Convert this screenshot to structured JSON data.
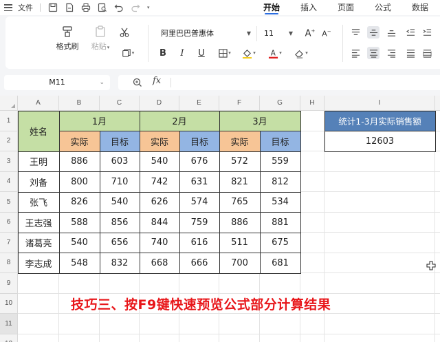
{
  "topbar": {
    "file_label": "文件",
    "tabs": [
      {
        "label": "开始",
        "active": true
      },
      {
        "label": "插入",
        "active": false
      },
      {
        "label": "页面",
        "active": false
      },
      {
        "label": "公式",
        "active": false
      },
      {
        "label": "数据",
        "active": false
      }
    ]
  },
  "ribbon": {
    "format_painter_label": "格式刷",
    "paste_label": "粘贴",
    "font_name": "阿里巴巴普惠体",
    "font_size": "11",
    "bold": "B",
    "italic": "I",
    "underline": "U"
  },
  "formula_bar": {
    "name_box": "M11",
    "fx": "fx",
    "formula": ""
  },
  "grid": {
    "columns": [
      "A",
      "B",
      "C",
      "D",
      "E",
      "F",
      "G",
      "H",
      "I"
    ],
    "rows": [
      "1",
      "2",
      "3",
      "4",
      "5",
      "6",
      "7",
      "8",
      "9",
      "10",
      "11",
      "12"
    ],
    "selected_row": "11"
  },
  "table": {
    "name_header": "姓名",
    "months": [
      "1月",
      "2月",
      "3月"
    ],
    "actual_label": "实际",
    "target_label": "目标",
    "records": [
      {
        "name": "王明",
        "values": [
          "886",
          "603",
          "540",
          "676",
          "572",
          "559"
        ]
      },
      {
        "name": "刘备",
        "values": [
          "800",
          "710",
          "742",
          "631",
          "821",
          "812"
        ]
      },
      {
        "name": "张飞",
        "values": [
          "826",
          "540",
          "626",
          "574",
          "765",
          "534"
        ]
      },
      {
        "name": "王志强",
        "values": [
          "588",
          "856",
          "844",
          "759",
          "886",
          "881"
        ]
      },
      {
        "name": "诸葛亮",
        "values": [
          "540",
          "656",
          "740",
          "616",
          "511",
          "675"
        ]
      },
      {
        "name": "李志成",
        "values": [
          "548",
          "832",
          "668",
          "666",
          "700",
          "681"
        ]
      }
    ]
  },
  "stat": {
    "header": "统计1-3月实际销售额",
    "value": "12603"
  },
  "caption": "技巧三、按F9键快速预览公式部分计算结果",
  "colors": {
    "header_green": "#c5dfa5",
    "actual_orange": "#f7c596",
    "target_blue": "#93b5e3",
    "stat_blue": "#5581b8",
    "caption_red": "#e8161a",
    "accent": "#2a6de0"
  }
}
